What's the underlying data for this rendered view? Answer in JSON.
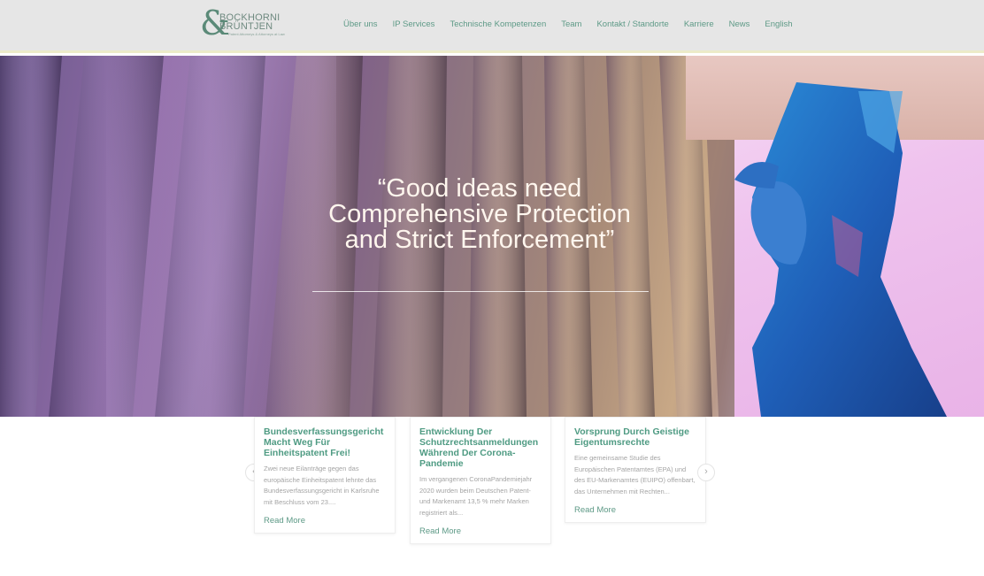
{
  "header": {
    "logo_line1": "BOCKHORNI",
    "logo_line2": "BRÜNTJEN",
    "logo_tagline": "Patent Attorneys & Attorneys at Law",
    "nav": [
      "Über uns",
      "IP Services",
      "Technische Kompetenzen",
      "Team",
      "Kontakt / Standorte",
      "Karriere",
      "News",
      "English"
    ]
  },
  "hero": {
    "quote": "“Good ideas need Comprehensive Protection and Strict Enforcement”"
  },
  "news": [
    {
      "title": "Bundesverfassungsgericht Macht Weg Für Einheitspatent Frei!",
      "text": "Zwei neue Eilanträge gegen das europäische Einheitspatent lehnte das Bundesverfassungsgericht in Karlsruhe mit Beschluss vom 23....",
      "more": "Read More"
    },
    {
      "title": "Entwicklung Der Schutzrechtsanmeldungen Während Der Corona-Pandemie",
      "text": "Im vergangenen CoronaPandemiejahr 2020 wurden beim Deutschen Patent- und Markenamt 13,5 % mehr Marken registriert als...",
      "more": "Read More"
    },
    {
      "title": "Vorsprung Durch Geistige Eigentumsrechte",
      "text": "Eine gemeinsame Studie des Europäischen Patentamtes (EPA) und des EU-Markenamtes (EUIPO) offenbart, das Unternehmen mit Rechten...",
      "more": "Read More"
    }
  ],
  "carousel": {
    "prev_icon": "chevron-left-icon",
    "next_icon": "chevron-right-icon"
  },
  "colors": {
    "accent": "#5e9a87",
    "header_bg": "#e6e6e6"
  }
}
